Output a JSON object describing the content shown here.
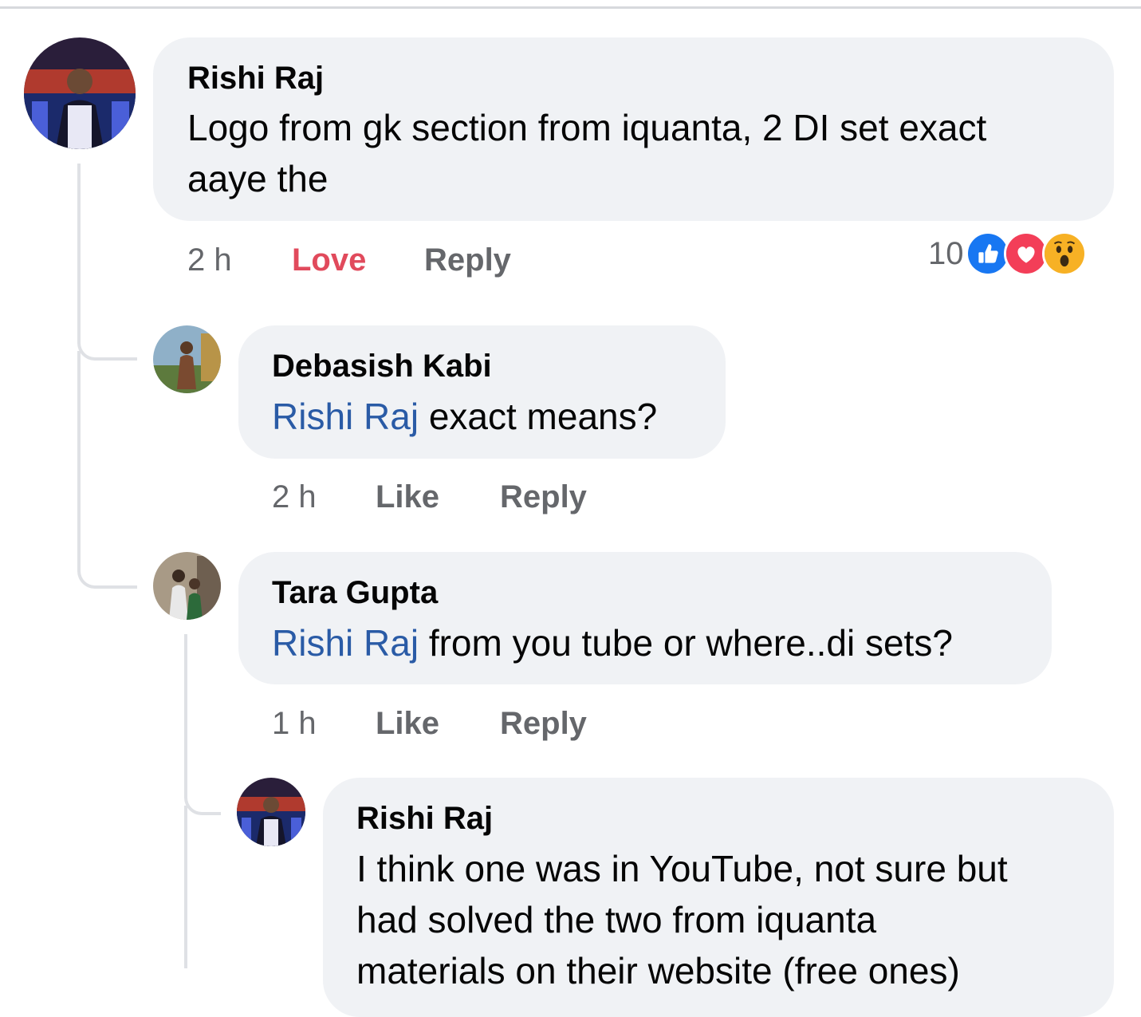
{
  "comments": [
    {
      "author": "Rishi Raj",
      "mention": "",
      "text_line1": "Logo from gk section from iquanta, 2 DI set exact",
      "text_line2": "aaye the",
      "time": "2 h",
      "action_like": "Love",
      "action_reply": "Reply",
      "reaction_count": "10",
      "reactions": [
        "like-icon",
        "love-icon",
        "wow-icon"
      ]
    },
    {
      "author": "Debasish Kabi",
      "mention": "Rishi Raj",
      "text": " exact means?",
      "time": "2 h",
      "action_like": "Like",
      "action_reply": "Reply"
    },
    {
      "author": "Tara Gupta",
      "mention": "Rishi Raj",
      "text": " from you tube or where..di sets?",
      "time": "1 h",
      "action_like": "Like",
      "action_reply": "Reply"
    },
    {
      "author": "Rishi Raj",
      "mention": "",
      "text_line1": "I think one was in YouTube, not sure but",
      "text_line2": "had solved the two from iquanta",
      "text_line3": "materials on their website (free ones)"
    }
  ],
  "colors": {
    "bubble": "#f0f2f5",
    "mention": "#2a5ba6",
    "love": "#e14a5c",
    "meta": "#65676b",
    "like_reaction": "#1877f2"
  }
}
